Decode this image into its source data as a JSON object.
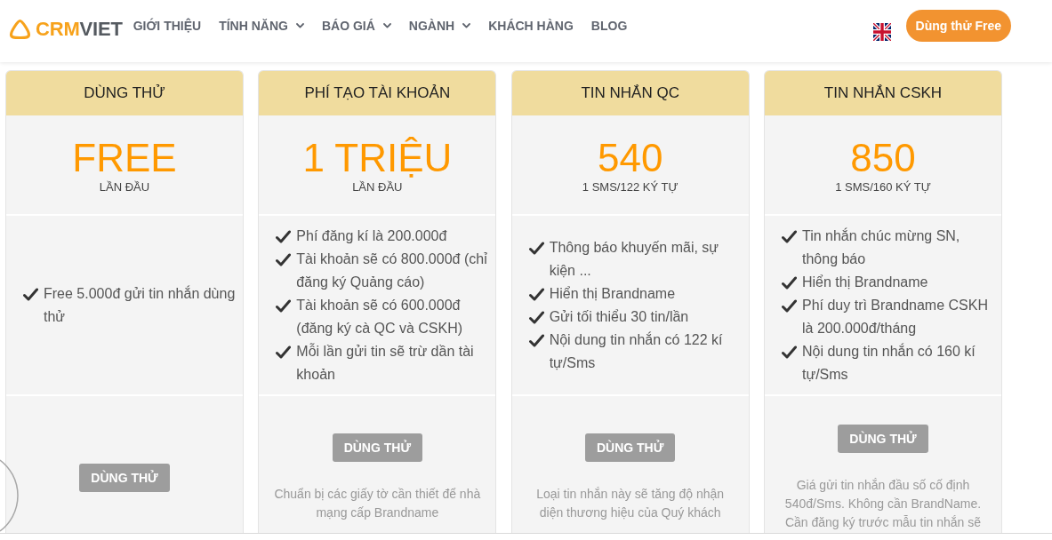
{
  "header": {
    "logo": {
      "accent": "CRM",
      "rest": "VIET"
    },
    "nav": [
      {
        "label": "GIỚI THIỆU",
        "dropdown": false
      },
      {
        "label": "TÍNH NĂNG",
        "dropdown": true
      },
      {
        "label": "BÁO GIÁ",
        "dropdown": true
      },
      {
        "label": "NGÀNH",
        "dropdown": true
      },
      {
        "label": "KHÁCH HÀNG",
        "dropdown": false
      },
      {
        "label": "BLOG",
        "dropdown": false
      }
    ],
    "cta_button": "Dùng thử Free"
  },
  "pricing_cards": [
    {
      "title": "DÙNG THỬ",
      "price": "FREE",
      "price_note": "LẦN ĐẦU",
      "features": [
        "Free 5.000đ gửi tin nhắn dùng thử"
      ],
      "button": "DÙNG THỬ"
    },
    {
      "title": "PHÍ TẠO TÀI KHOẢN",
      "price": "1 TRIỆU",
      "price_note": "LẦN ĐẦU",
      "features": [
        "Phí đăng kí là 200.000đ",
        "Tài khoản sẽ có 800.000đ (chỉ đăng ký Quảng cáo)",
        "Tài khoản sẽ có 600.000đ (đăng ký cà QC và CSKH)",
        "Mỗi lần gửi tin sẽ trừ dần tài khoản"
      ],
      "button": "DÙNG THỬ",
      "note": "Chuẩn bị các giấy tờ cần thiết để nhà mạng cấp Brandname"
    },
    {
      "title": "TIN NHẮN QC",
      "price": "540",
      "price_note": "1 SMS/122 KÝ TỰ",
      "features": [
        "Thông báo khuyến mãi, sự kiện ...",
        "Hiển thị Brandname",
        "Gửi tối thiểu 30 tin/lần",
        "Nội dung tin nhắn có 122 kí tự/Sms"
      ],
      "button": "DÙNG THỬ",
      "note": "Loại tin nhắn này sẽ tăng độ nhận diện thương hiệu của Quý khách"
    },
    {
      "title": "TIN NHẮN CSKH",
      "price": "850",
      "price_note": "1 SMS/160 KÝ TỰ",
      "features": [
        "Tin nhắn chúc mừng SN, thông báo",
        "Hiển thị Brandname",
        "Phí duy trì Brandname CSKH là 200.000đ/tháng",
        "Nội dung tin nhắn có 160 kí tự/Sms"
      ],
      "button": "DÙNG THỬ",
      "note": "Giá gửi tin nhắn đầu số cố định 540đ/Sms. Không cần BrandName. Cần đăng ký trước mẫu tin nhắn sẽ"
    }
  ]
}
